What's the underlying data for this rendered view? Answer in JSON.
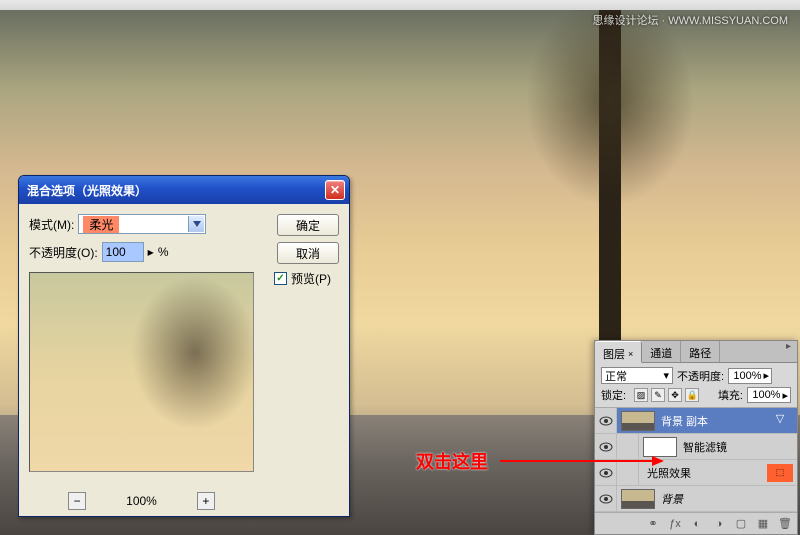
{
  "watermark": "思缘设计论坛 · WWW.MISSYUAN.COM",
  "dialog": {
    "title": "混合选项（光照效果）",
    "mode_label": "模式(M):",
    "mode_value": "柔光",
    "opacity_label": "不透明度(O):",
    "opacity_value": "100",
    "opacity_unit": "%",
    "ok": "确定",
    "cancel": "取消",
    "preview": "预览(P)",
    "zoom_minus": "−",
    "zoom_value": "100%",
    "zoom_plus": "+"
  },
  "panel": {
    "tabs": [
      "图层",
      "通道",
      "路径"
    ],
    "blend_mode": "正常",
    "opacity_label": "不透明度:",
    "opacity_value": "100%",
    "lock_label": "锁定:",
    "fill_label": "填充:",
    "fill_value": "100%",
    "layers": [
      {
        "name": "背景 副本",
        "active": true
      },
      {
        "name": "智能滤镜"
      },
      {
        "name": "光照效果",
        "highlight": true
      },
      {
        "name": "背景",
        "italic": true
      }
    ]
  },
  "annotation": "双击这里"
}
